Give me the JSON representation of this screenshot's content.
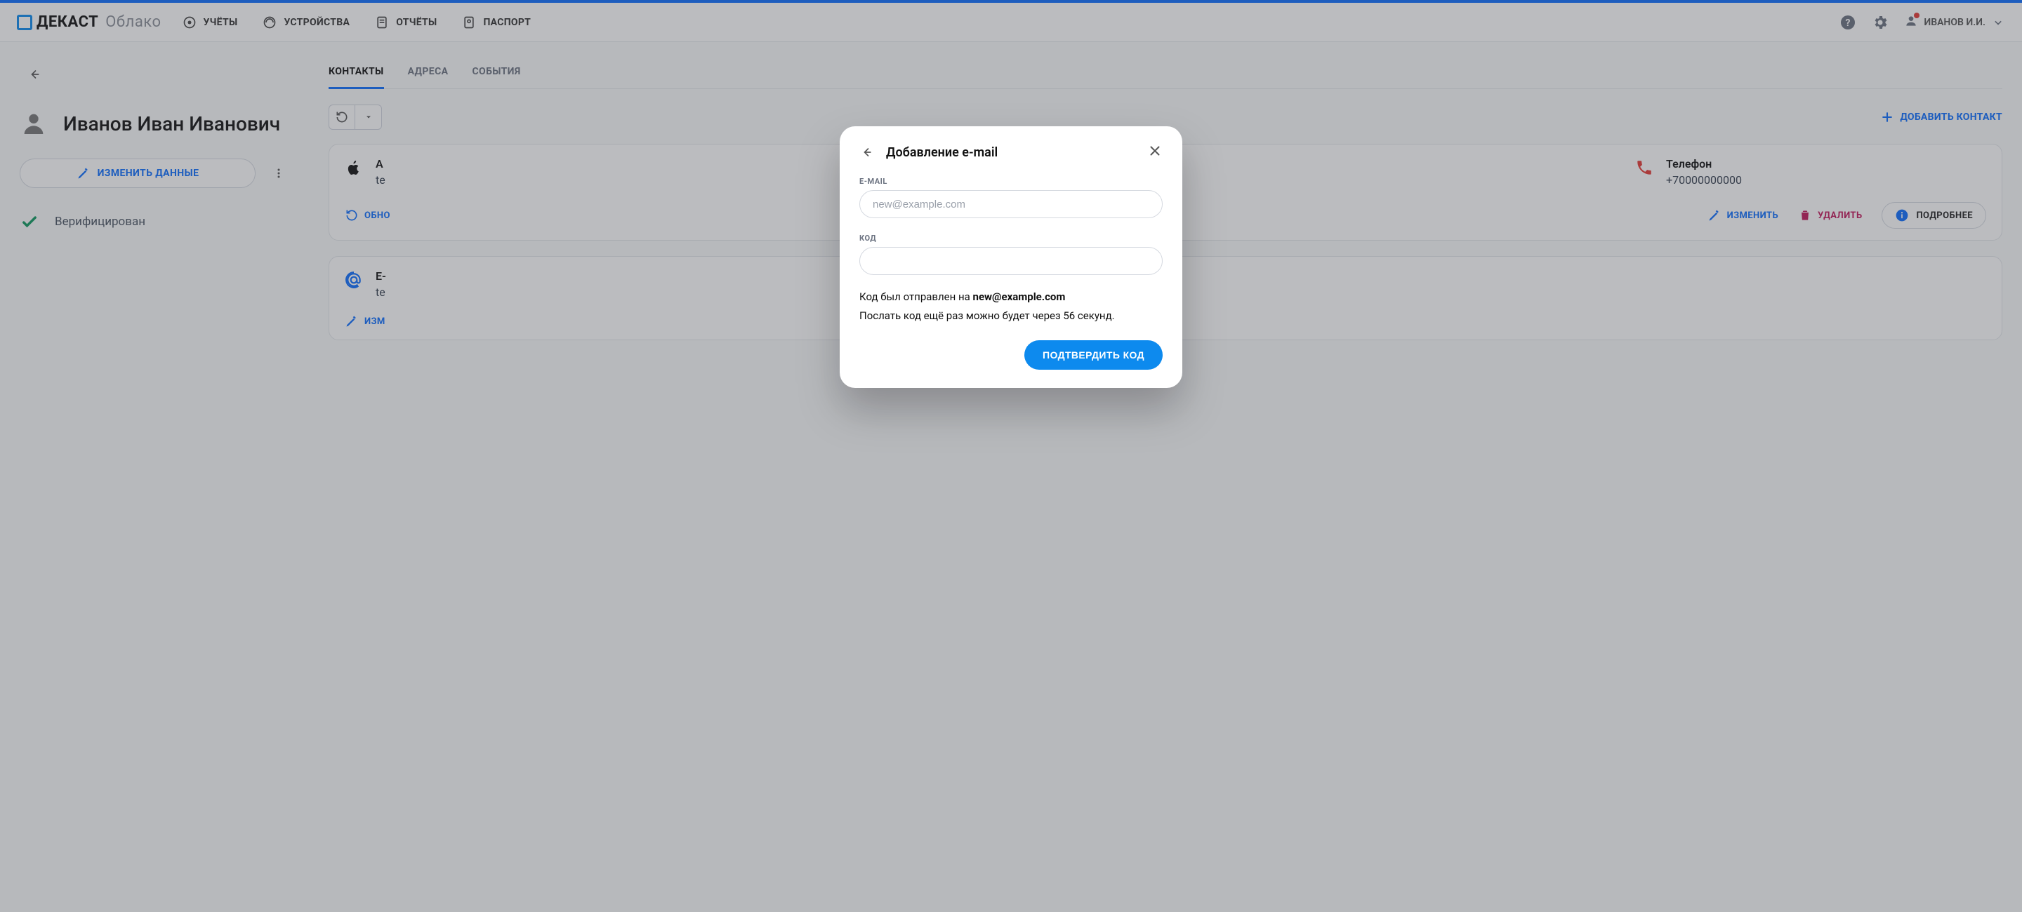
{
  "brand": {
    "name": "ДЕКАСТ",
    "suffix": "Облако"
  },
  "nav": {
    "accounts": "УЧЁТЫ",
    "devices": "УСТРОЙСТВА",
    "reports": "ОТЧЁТЫ",
    "passport": "ПАСПОРТ"
  },
  "user": {
    "name": "ИВАНОВ И.И."
  },
  "left": {
    "person_name": "Иванов Иван Иванович",
    "edit_label": "ИЗМЕНИТЬ ДАННЫЕ",
    "verified_label": "Верифицирован"
  },
  "tabs": {
    "contacts": "КОНТАКТЫ",
    "addresses": "АДРЕСА",
    "events": "СОБЫТИЯ"
  },
  "toolbar": {
    "add_contact": "ДОБАВИТЬ КОНТАКТ"
  },
  "contacts": [
    {
      "icon": "apple",
      "title": "A",
      "sub": "te",
      "right_icon": "phone",
      "right_title": "Телефон",
      "right_sub": "+70000000000",
      "actions": {
        "refresh": "ОБНО",
        "edit": "ИЗМЕНИТЬ",
        "delete": "УДАЛИТЬ",
        "details": "ПОДРОБНЕЕ"
      }
    },
    {
      "icon": "at",
      "title": "E-",
      "sub": "te",
      "actions": {
        "edit": "ИЗМ"
      }
    }
  ],
  "modal": {
    "title": "Добавление e-mail",
    "email_label": "E-MAIL",
    "email_placeholder": "new@example.com",
    "code_label": "КОД",
    "sent_prefix": "Код был отправлен на ",
    "sent_email": "new@example.com",
    "resend_text": "Послать код ещё раз можно будет через 56 секунд.",
    "submit": "ПОДТВЕРДИТЬ КОД"
  }
}
